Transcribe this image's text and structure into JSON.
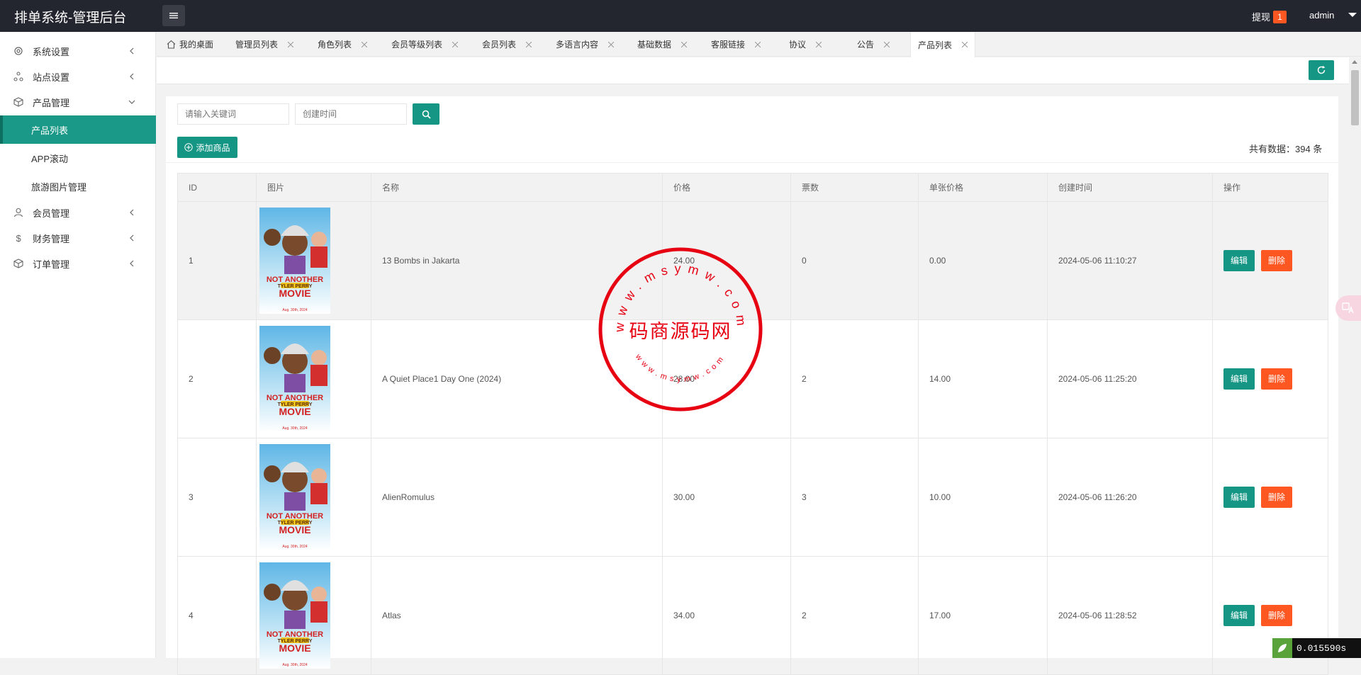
{
  "app": {
    "title": "排单系统-管理后台",
    "withdraw_label": "提现",
    "withdraw_count": "1",
    "user": "admin"
  },
  "sidebar": {
    "items": [
      {
        "label": "系统设置",
        "icon": "gear-icon"
      },
      {
        "label": "站点设置",
        "icon": "network-icon"
      },
      {
        "label": "产品管理",
        "icon": "box-icon"
      },
      {
        "label": "会员管理",
        "icon": "user-icon"
      },
      {
        "label": "财务管理",
        "icon": "dollar-icon"
      },
      {
        "label": "订单管理",
        "icon": "box-icon"
      }
    ],
    "sub_items": [
      {
        "label": "产品列表"
      },
      {
        "label": "APP滚动"
      },
      {
        "label": "旅游图片管理"
      }
    ]
  },
  "tabs": [
    {
      "label": "我的桌面"
    },
    {
      "label": "管理员列表"
    },
    {
      "label": "角色列表"
    },
    {
      "label": "会员等级列表"
    },
    {
      "label": "会员列表"
    },
    {
      "label": "多语言内容"
    },
    {
      "label": "基础数据"
    },
    {
      "label": "客服链接"
    },
    {
      "label": "协议"
    },
    {
      "label": "公告"
    },
    {
      "label": "产品列表"
    }
  ],
  "filters": {
    "keyword_placeholder": "请输入关键词",
    "date_placeholder": "创建时间"
  },
  "toolbar": {
    "add_label": "添加商品",
    "total_text": "共有数据：394 条"
  },
  "table": {
    "headers": [
      "ID",
      "图片",
      "名称",
      "价格",
      "票数",
      "单张价格",
      "创建时间",
      "操作"
    ],
    "rows": [
      {
        "id": "1",
        "name": "13 Bombs in Jakarta",
        "price": "24.00",
        "votes": "0",
        "unit_price": "0.00",
        "created": "2024-05-06 11:10:27"
      },
      {
        "id": "2",
        "name": "A Quiet Place1 Day One (2024)",
        "price": "28.00",
        "votes": "2",
        "unit_price": "14.00",
        "created": "2024-05-06 11:25:20"
      },
      {
        "id": "3",
        "name": "AlienRomulus",
        "price": "30.00",
        "votes": "3",
        "unit_price": "10.00",
        "created": "2024-05-06 11:26:20"
      },
      {
        "id": "4",
        "name": "Atlas",
        "price": "34.00",
        "votes": "2",
        "unit_price": "17.00",
        "created": "2024-05-06 11:28:52"
      }
    ],
    "edit_label": "编辑",
    "delete_label": "删除"
  },
  "poster": {
    "line1": "NOT ANOTHER",
    "line2": "TYLER PERRY",
    "line3": "MOVIE",
    "date": "Aug. 30th, 2024"
  },
  "watermark": {
    "top_url": "www.msymw.com",
    "center": "码商源码网",
    "bottom_url": "www.msymw.com"
  },
  "timer": "0.015590s",
  "colors": {
    "primary": "#159684",
    "danger": "#ff5722",
    "topbar": "#23262e",
    "stamp": "#e60012"
  }
}
